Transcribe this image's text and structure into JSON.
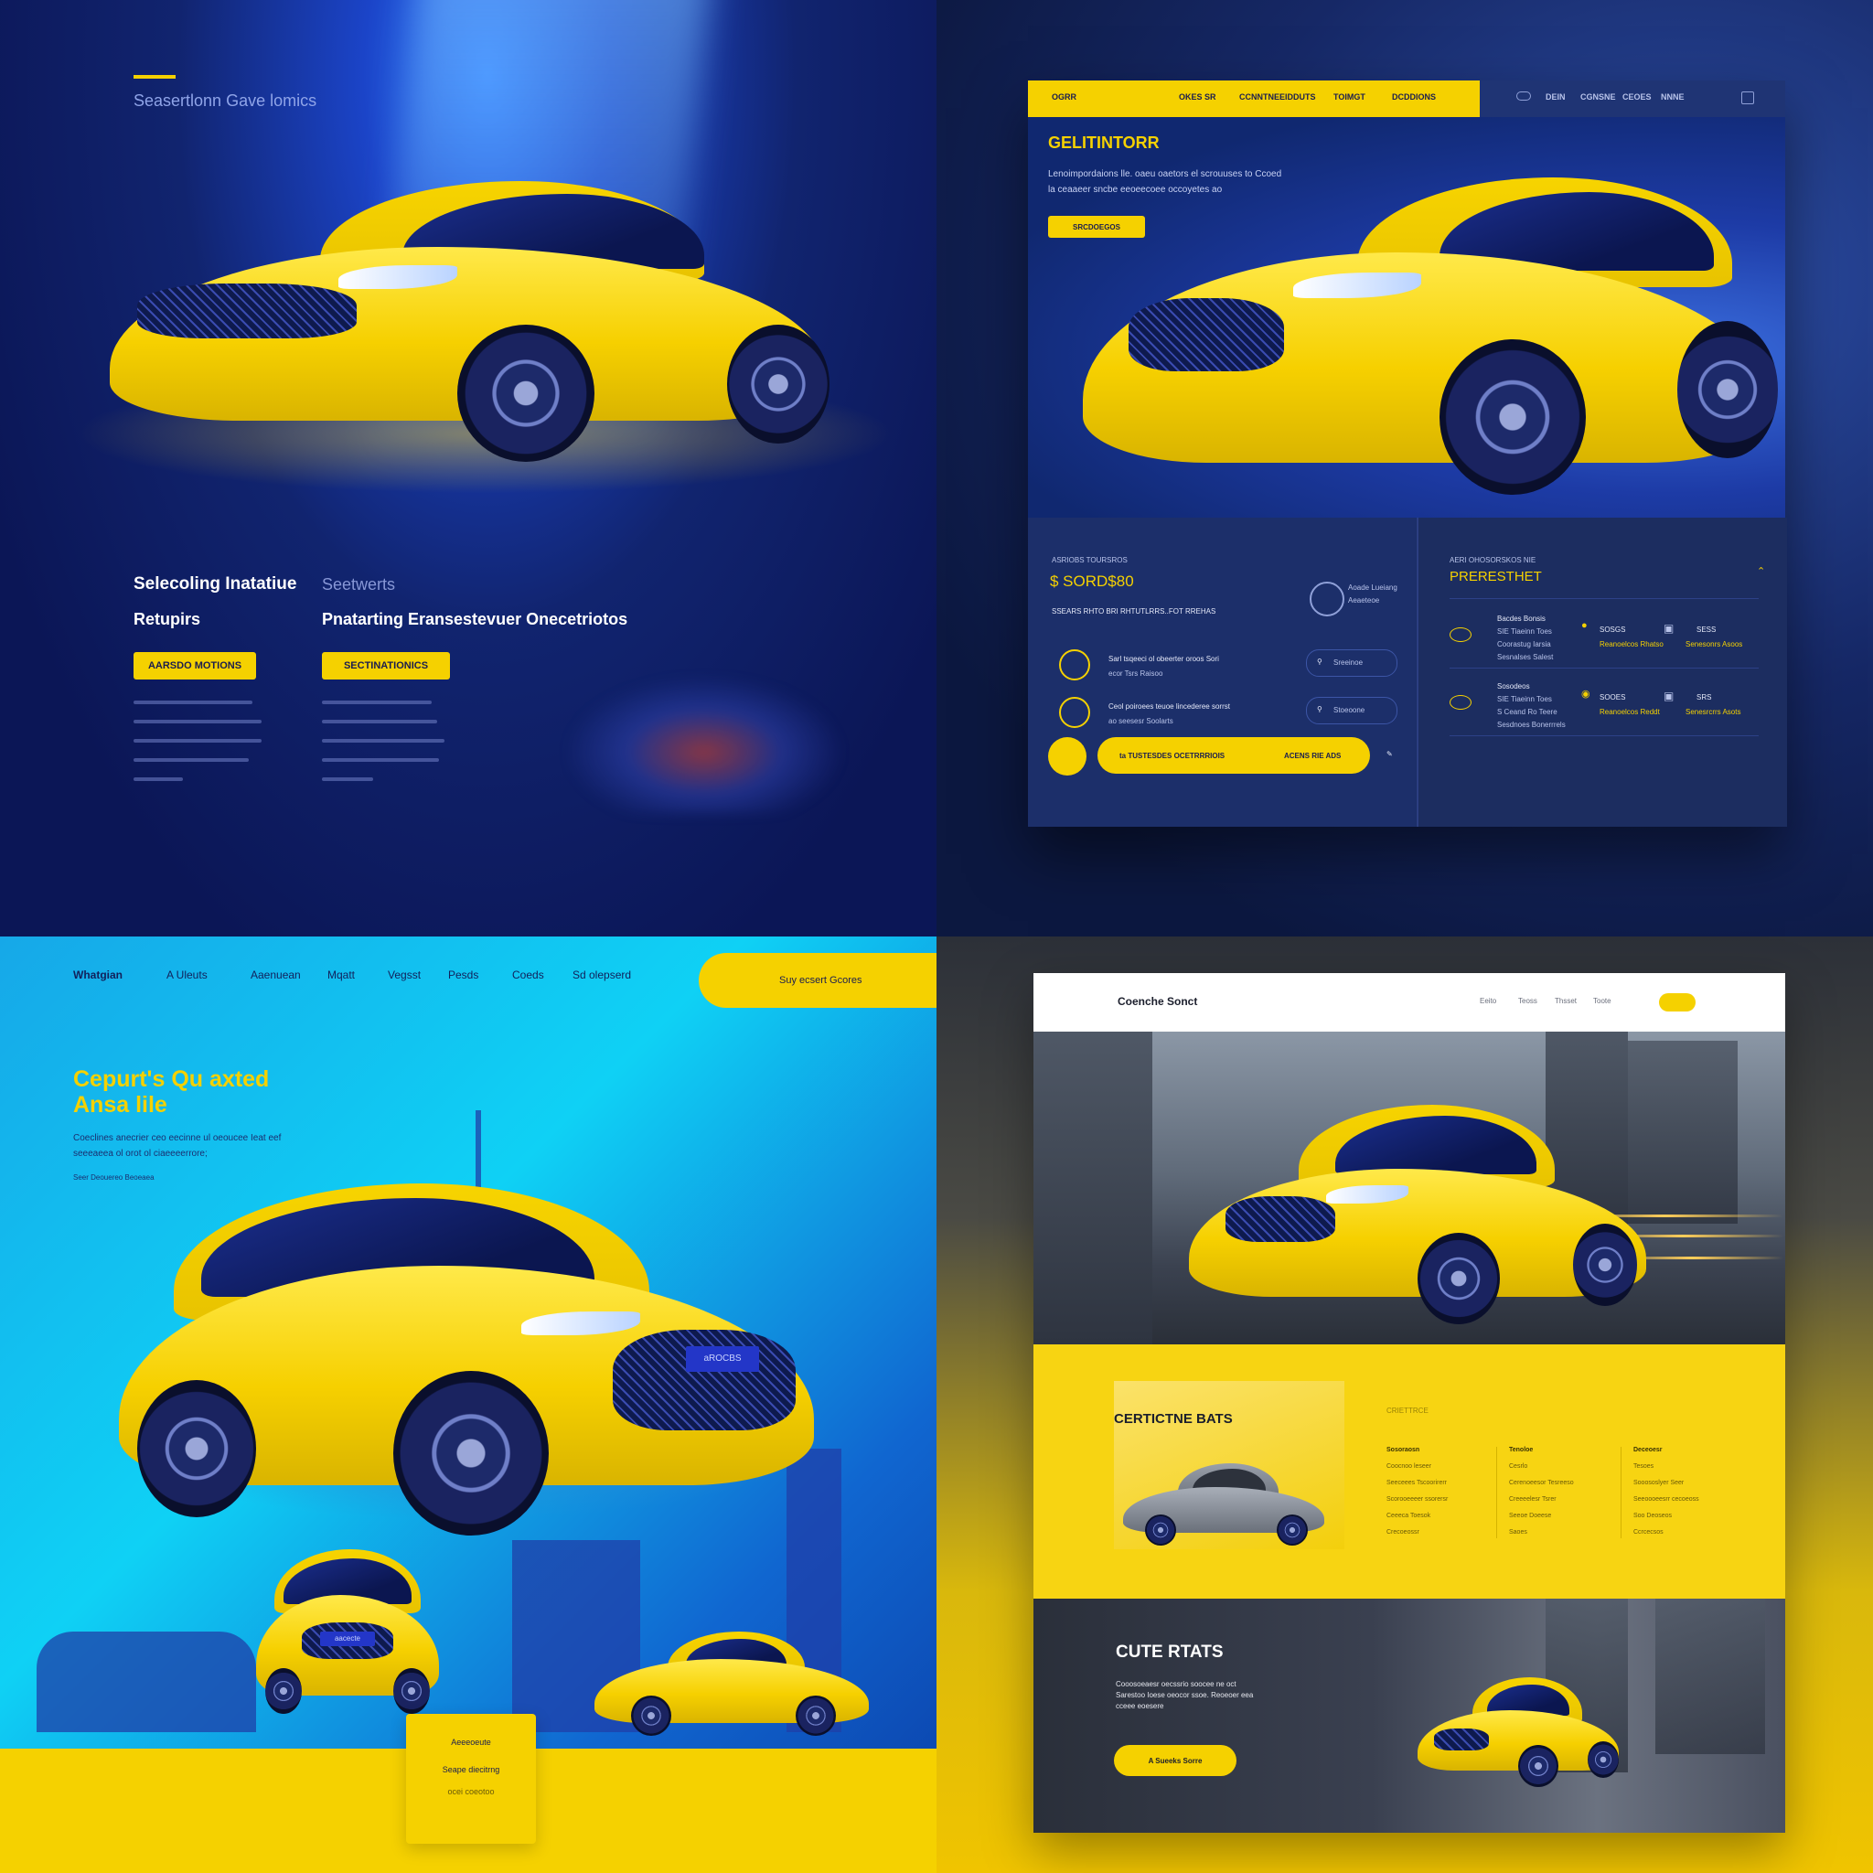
{
  "q1": {
    "title": "Seasertlonn Gave lomics",
    "heading_left": "Selecoling Inatatiue",
    "heading_left_sub": "Retupirs",
    "heading_right_small": "Seetwerts",
    "heading_right": "Pnatarting Eransestevuer Onecetriotos",
    "button_left": "AARSDO MOTIONS",
    "button_right": "SECTINATIONICS"
  },
  "q2": {
    "nav_yellow": [
      "OGRR",
      "OKES SR",
      "CCNNTNEEIDDUTS",
      "TOIMGT",
      "DCDDIONS"
    ],
    "nav_blue": [
      "DEIN",
      "CGNSNE",
      "CEOES",
      "NNNE"
    ],
    "hero_title": "GELITINTORR",
    "hero_text": "Lenoimpordaions lle. oaeu oaetors el scrouuses to Ccoed la ceaaeer sncbe eeoeecoee occoyetes ao",
    "hero_button": "SRCDOEGOS",
    "price_caption": "ASRIOBS TOURSROS",
    "price": "$ SORD$80",
    "price_subtitle": "SSEARS RHTO BRI RHTUTLRRS..FOT RREHAS",
    "assist_label": "Aoade Lueiang Aeaeteoe",
    "features": [
      {
        "text": "Sarl tsqeeci ol obeerter oroos Sori",
        "sub": "ecor Tsrs Raisoo"
      },
      {
        "text": "Ceol poiroees teuoe lincederee sorrst",
        "sub": "ao seesesr Soolarts"
      }
    ],
    "search_a": "Sreeinoe",
    "search_b": "Stoeoone",
    "book_label": "ta TUSTESDES OCETRRRIOIS",
    "book_label_right": "ACENS RIE ADS",
    "panel_caption": "AERI OHOSORSKOS NIE",
    "panel_title": "PRERESTHET",
    "rows": [
      {
        "name": "Bacdes Bonsis",
        "lines": [
          "SIE Tiaeinn Toes",
          "Coorastug Iarsia",
          "Sesnalses Salest"
        ],
        "v1": "SOSGS",
        "v1_sub": "Reanoelcos Rhatso",
        "v2": "SESS",
        "v2_sub": "Senesonrs Asoos"
      },
      {
        "name": "Sosodeos",
        "lines": [
          "SIE Tiaeinn Toes",
          "S Ceand Ro Teere",
          "Sesdnoes Bonerrrels"
        ],
        "v1": "SOOES",
        "v1_sub": "Reanoelcos Reddt",
        "v2": "SRS",
        "v2_sub": "Senesrcrrs Asots"
      }
    ]
  },
  "q3": {
    "nav": [
      "Whatgian",
      "A Uleuts",
      "Aaenuean",
      "Mqatt",
      "Vegsst",
      "Pesds",
      "Coeds",
      "Sd olepserd"
    ],
    "nav_button": "Suy ecsert Gcores",
    "title_line1": "Cepurt's Qu axted",
    "title_line2": "Ansa lile",
    "text": "Coeclines anecrier ceo eecinne ul oeoucee Ieat eef seeeaeea ol orot ol ciaeeeerrore;",
    "small": "Seer Deouereo Beoeaea",
    "plate_main": "aROCBS",
    "plate_small": "aacecte",
    "card_title": "Aeeeoeute",
    "card_line": "Seape diecitrng",
    "card_line2": "ocei coeotoo"
  },
  "q4": {
    "brand": "Coenche Sonct",
    "nav_links": [
      "Eeito",
      "Teoss",
      "Thsset",
      "Toote"
    ],
    "mid_title": "CERTICTNE BATS",
    "mid_caption": "CRIETTRCE",
    "columns": [
      {
        "head": "Sosoraosn",
        "lines": [
          "Coocnoo leseer",
          "Seeceees Tscoorirerr",
          "Scorooeeeer ssorersr",
          "Ceeeca Toesok",
          "Crecoeossr"
        ]
      },
      {
        "head": "Tenoloe",
        "lines": [
          "Cesrlo",
          "Cerenoeesor Tesreeso",
          "Creeeelesr Tsrer",
          "Seeoe Doeese",
          "Saoes"
        ]
      },
      {
        "head": "Deceoesr",
        "lines": [
          "Tesoes",
          "Sooososlyer Seer",
          "Seeoooeesrr cecoeoss",
          "Soo Deoseos",
          "Ccrcecsos"
        ]
      }
    ],
    "bottom_title": "CUTE RTATS",
    "bottom_text": "Cooosoeaesr oecssrio soocee ne oct Sarestoo Ioese oeocor ssoe. Reoeoer eea cceee eoesere",
    "bottom_button": "A Sueeks Sorre"
  },
  "colors": {
    "yellow": "#f5d100",
    "navy": "#1a2d66",
    "cyan": "#0fd1f5",
    "dark": "#2a2f3a"
  }
}
